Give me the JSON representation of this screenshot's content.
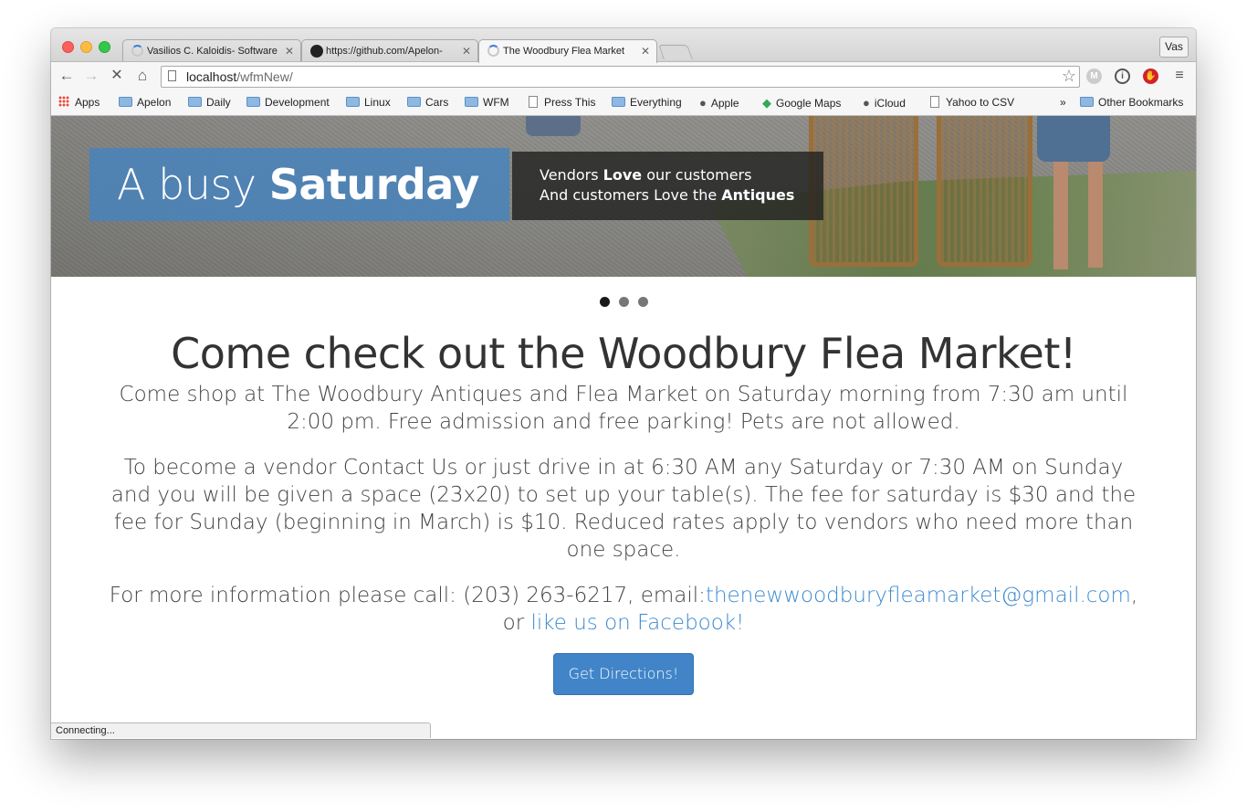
{
  "browser": {
    "tabs": [
      {
        "title": "Vasilios C. Kaloidis- Software",
        "icon": "loading-spinner"
      },
      {
        "title": "https://github.com/Apelon-",
        "icon": "github-icon"
      },
      {
        "title": "The Woodbury Flea Market",
        "icon": "loading-spinner"
      }
    ],
    "profile": "Vas",
    "url_host": "localhost",
    "url_path": "/wfmNew/",
    "status": "Connecting..."
  },
  "bookmarks": {
    "items": [
      "Apps",
      "Apelon",
      "Daily",
      "Development",
      "Linux",
      "Cars",
      "WFM",
      "Press This",
      "Everything",
      "Apple",
      "Google Maps",
      "iCloud",
      "Yahoo to CSV"
    ],
    "overflow": "»",
    "other": "Other Bookmarks"
  },
  "hero": {
    "title_light": "A busy ",
    "title_bold": "Saturday",
    "line1_pre": "Vendors ",
    "line1_bold": "Love",
    "line1_post": " our customers",
    "line2_pre": "And customers Love the ",
    "line2_bold": "Antiques",
    "carousel_count": 3,
    "carousel_active": 1
  },
  "main": {
    "heading": "Come check out the Woodbury Flea Market!",
    "para1": "Come shop at The Woodbury Antiques and Flea Market on Saturday morning from 7:30 am until 2:00 pm. Free admission and free parking! Pets are not allowed.",
    "para2": "To become a vendor Contact Us or just drive in at 6:30 AM any Saturday or 7:30 AM on Sunday and you will be given a space (23x20) to set up your table(s). The fee for saturday is $30 and the fee for Sunday (beginning in March) is $10. Reduced rates apply to vendors who need more than one space.",
    "para3_pre": "For more information please call: (203) 263-6217, email:",
    "email": "thenewwoodburyfleamarket@gmail.com",
    "para3_mid": ",",
    "para3_or": "or ",
    "facebook": "like us on Facebook!",
    "directions_button": "Get Directions!"
  },
  "colors": {
    "link": "#3e8ad0",
    "button": "#4185c8",
    "caption_blue": "#4682be",
    "caption_dark": "#1e1e1e"
  }
}
